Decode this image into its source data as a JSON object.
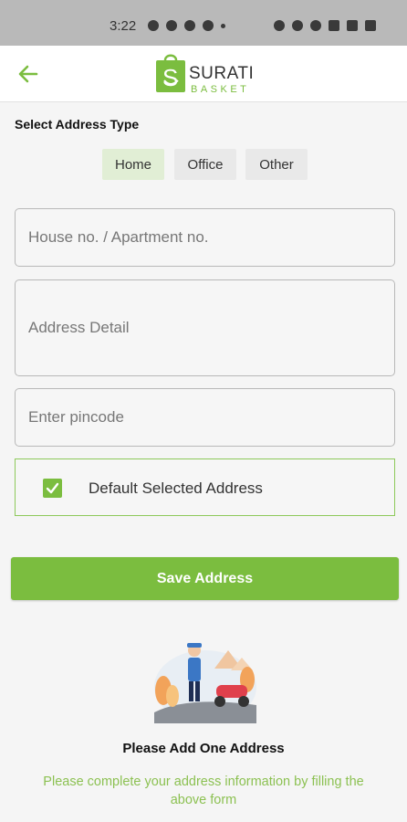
{
  "status_bar": {
    "time": "3:22"
  },
  "header": {
    "logo_text_main": "SURATI",
    "logo_text_sub": "BASKET"
  },
  "address_type": {
    "title": "Select Address Type",
    "options": [
      "Home",
      "Office",
      "Other"
    ],
    "selected": "Home"
  },
  "form": {
    "house_placeholder": "House no. / Apartment no.",
    "detail_placeholder": "Address Detail",
    "pincode_placeholder": "Enter pincode",
    "default_label": "Default Selected Address",
    "default_checked": true,
    "save_label": "Save Address"
  },
  "empty_state": {
    "title": "Please Add One Address",
    "description": "Please complete your address information by filling the above form"
  },
  "colors": {
    "accent": "#7bbd3f",
    "selected_type_bg": "#e1eed5",
    "status_bar_bg": "#b9b9b9"
  }
}
